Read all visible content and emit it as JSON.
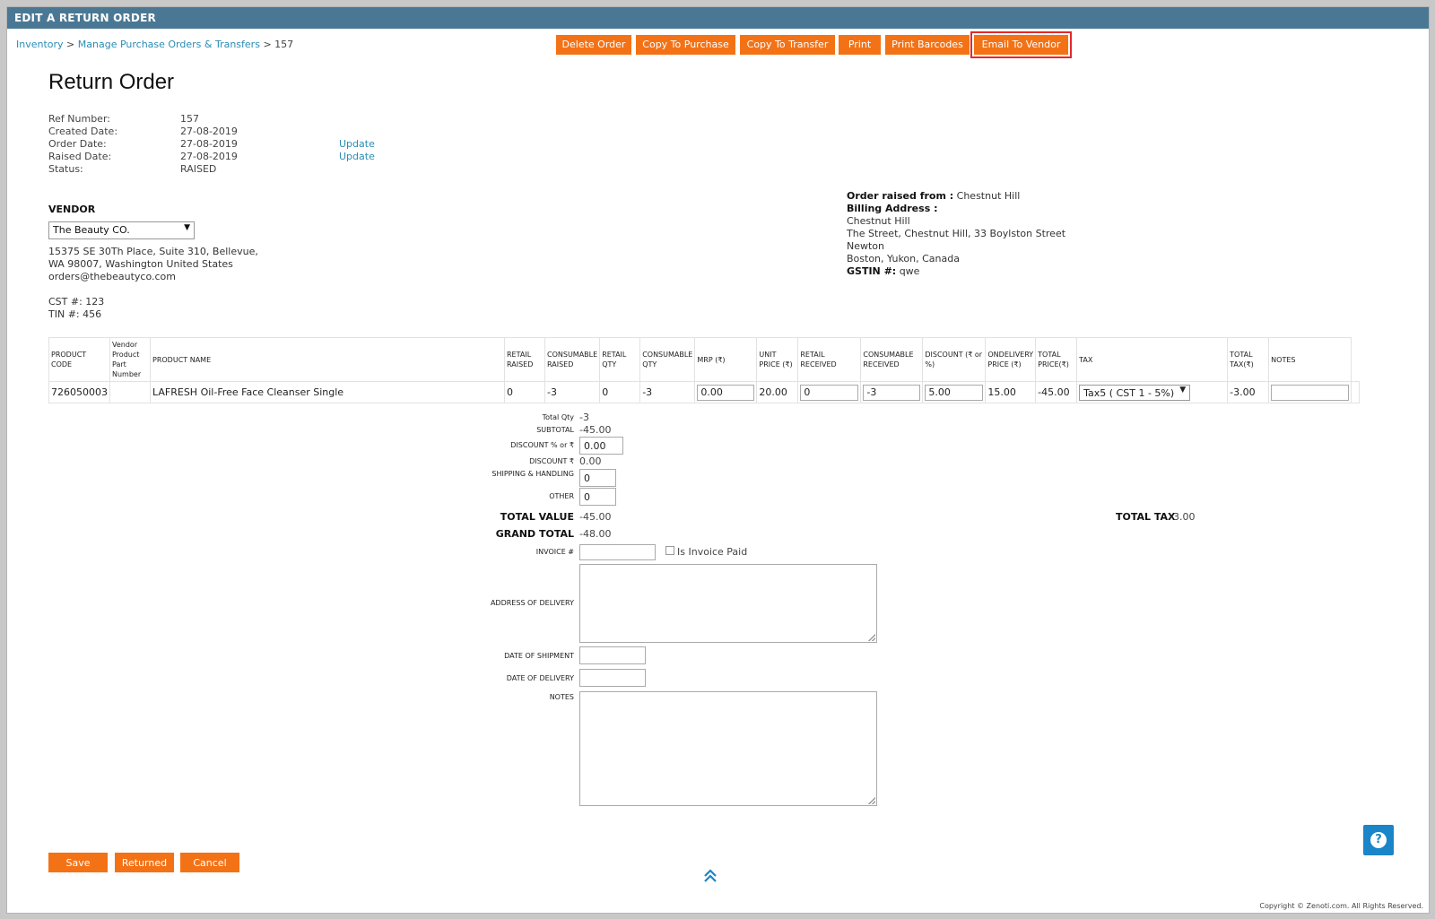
{
  "window": {
    "title": "EDIT A RETURN ORDER"
  },
  "breadcrumb": {
    "items": [
      "Inventory",
      "Manage Purchase Orders & Transfers"
    ],
    "current": "157"
  },
  "actions": {
    "delete_order": "Delete Order",
    "copy_to_purchase": "Copy To Purchase",
    "copy_to_transfer": "Copy To Transfer",
    "print": "Print",
    "print_barcodes": "Print Barcodes",
    "email_to_vendor": "Email To Vendor"
  },
  "page": {
    "title": "Return Order"
  },
  "meta": {
    "ref_label": "Ref Number:",
    "ref_value": "157",
    "created_label": "Created Date:",
    "created_value": "27-08-2019",
    "order_label": "Order Date:",
    "order_value": "27-08-2019",
    "order_update": "Update",
    "raised_label": "Raised Date:",
    "raised_value": "27-08-2019",
    "raised_update": "Update",
    "status_label": "Status:",
    "status_value": "RAISED"
  },
  "vendor": {
    "heading": "VENDOR",
    "selected": "The Beauty CO.",
    "address_line1": "15375 SE 30Th Place, Suite 310, Bellevue,",
    "address_line2": "WA 98007, Washington United States",
    "email": "orders@thebeautyco.com",
    "cst": "CST #: 123",
    "tin": "TIN #: 456"
  },
  "billing": {
    "raised_from_label": "Order raised from :",
    "raised_from_value": "Chestnut Hill",
    "billing_label": "Billing Address :",
    "line1": "Chestnut Hill",
    "line2": "The Street, Chestnut Hill, 33 Boylston Street",
    "line3": "Newton",
    "line4": "Boston, Yukon, Canada",
    "gstin_label": "GSTIN #:",
    "gstin_value": "qwe"
  },
  "table": {
    "headers": {
      "product_code": "PRODUCT CODE",
      "vendor_part": "Vendor Product Part Number",
      "product_name": "PRODUCT NAME",
      "retail_raised": "RETAIL RAISED",
      "consumable_raised": "CONSUMABLE RAISED",
      "retail_qty": "RETAIL QTY",
      "consumable_qty": "CONSUMABLE QTY",
      "mrp": "MRP (₹)",
      "unit_price": "UNIT PRICE (₹)",
      "retail_received": "RETAIL RECEIVED",
      "consumable_received": "CONSUMABLE RECEIVED",
      "discount": "DISCOUNT (₹ or %)",
      "ondelivery_price": "ONDELIVERY PRICE (₹)",
      "total_price": "TOTAL PRICE(₹)",
      "tax": "TAX",
      "total_tax": "TOTAL TAX(₹)",
      "notes": "NOTES"
    },
    "rows": [
      {
        "product_code": "726050003",
        "vendor_part": "",
        "product_name": "LAFRESH Oil-Free Face Cleanser Single",
        "retail_raised": "0",
        "consumable_raised": "-3",
        "retail_qty": "0",
        "consumable_qty": "-3",
        "mrp": "0.00",
        "unit_price": "20.00",
        "retail_received": "0",
        "consumable_received": "-3",
        "discount": "5.00",
        "ondelivery_price": "15.00",
        "total_price": "-45.00",
        "tax": "Tax5 ( CST 1 - 5%)",
        "total_tax": "-3.00",
        "notes": ""
      }
    ]
  },
  "summary": {
    "total_qty_label": "Total Qty",
    "total_qty_value": "-3",
    "subtotal_label": "SUBTOTAL",
    "subtotal_value": "-45.00",
    "discount_pct_label": "DISCOUNT % or ₹",
    "discount_pct_value": "0.00",
    "discount_label": "DISCOUNT ₹",
    "discount_value": "0.00",
    "shipping_label": "SHIPPING & HANDLING",
    "shipping_value": "0",
    "other_label": "OTHER",
    "other_value": "0",
    "total_value_label": "TOTAL VALUE",
    "total_value_value": "-45.00",
    "total_tax_label": "TOTAL TAX",
    "total_tax_value": "-3.00",
    "grand_total_label": "GRAND TOTAL",
    "grand_total_value": "-48.00",
    "invoice_label": "INVOICE #",
    "invoice_value": "",
    "invoice_paid_label": "Is Invoice Paid",
    "address_delivery_label": "ADDRESS OF DELIVERY",
    "date_shipment_label": "DATE OF SHIPMENT",
    "date_delivery_label": "DATE OF DELIVERY",
    "notes_label": "NOTES"
  },
  "footer": {
    "save": "Save",
    "returned": "Returned",
    "cancel": "Cancel",
    "copyright": "Copyright © Zenoti.com. All Rights Reserved."
  },
  "colors": {
    "accent": "#f47216",
    "titlebar": "#4a7894",
    "link": "#2b8cb5",
    "highlight": "#e22a2a",
    "help": "#1a85c8"
  },
  "icons": {
    "scroll_top": "double-chevron-up-icon",
    "help": "question-icon",
    "dropdown": "caret-down-icon"
  }
}
